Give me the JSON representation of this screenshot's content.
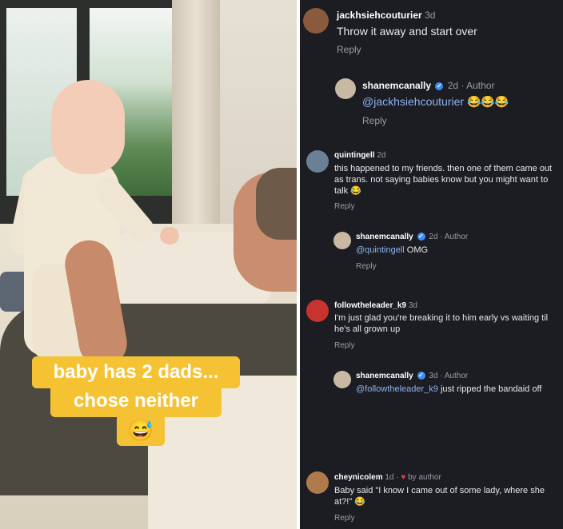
{
  "caption": {
    "line1": "baby has 2 dads...",
    "line2": "chose neither",
    "emoji": "😅"
  },
  "comments": [
    {
      "username": "jackhsiehcouturier",
      "age": "3d",
      "text": "Throw it away and start over",
      "reply": "Reply",
      "avatar_color": "#8a5a3c"
    },
    {
      "username": "shanemcanally",
      "age": "2d",
      "author": "Author",
      "mention": "@jackhsiehcouturier",
      "text": "",
      "emoji": "😂😂😂",
      "reply": "Reply",
      "avatar_color": "#c9b8a4"
    },
    {
      "username": "quintingell",
      "age": "2d",
      "text": "this happened to my friends. then one of them came out as trans. not saying babies know but you might want to talk",
      "emoji": "😂",
      "reply": "Reply",
      "avatar_color": "#6b7f95"
    },
    {
      "username": "shanemcanally",
      "age": "2d",
      "author": "Author",
      "mention": "@quintingell",
      "text": "OMG",
      "reply": "Reply",
      "avatar_color": "#c9b8a4"
    },
    {
      "username": "followtheleader_k9",
      "age": "3d",
      "text": "I'm just glad you're breaking it to him early vs waiting til he's all grown up",
      "reply": "Reply",
      "avatar_color": "#c7332f"
    },
    {
      "username": "shanemcanally",
      "age": "3d",
      "author": "Author",
      "mention": "@followtheleader_k9",
      "text": "just ripped the bandaid off",
      "reply": "",
      "avatar_color": "#c9b8a4"
    },
    {
      "username": "cheynicolem",
      "age": "1d",
      "liked_by": "by author",
      "text": "Baby said \"I know I came out of some lady, where she at?!\"",
      "emoji": "😂",
      "reply": "Reply",
      "avatar_color": "#b07a4d"
    }
  ],
  "icons": {
    "verified": "verified-badge-icon",
    "heart": "heart-icon"
  },
  "colors": {
    "panel_bg": "#1b1d22",
    "caption_bg": "#f5c233",
    "mention": "#8fb2f2",
    "verified": "#3b8ef5",
    "heart": "#e83b4a"
  }
}
